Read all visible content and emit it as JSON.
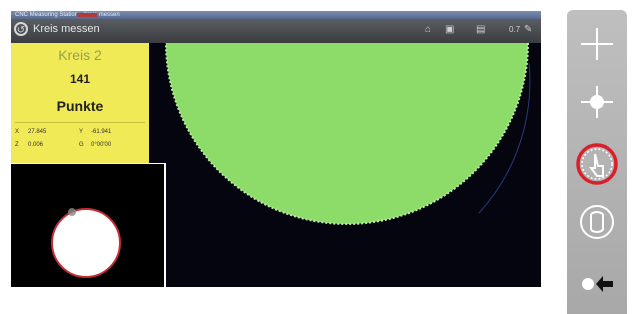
{
  "window": {
    "title_bar_text": "CNC Measuring Station - Kreis messen"
  },
  "toolbar": {
    "back_icon": "back-arrow-icon",
    "title": "Kreis messen",
    "icons": [
      "home-icon",
      "camera-icon",
      "keyboard-icon"
    ],
    "zoom_label": "0.7",
    "pen_icon": "pen-icon"
  },
  "panel": {
    "feature": "Kreis 2",
    "count": "141",
    "unit": "Punkte",
    "x_label": "X",
    "x_value": "27.845",
    "y_label": "Y",
    "y_value": "-61.941",
    "z_label": "Z",
    "z_value": "0.006",
    "g_label": "G",
    "g_value": "0°00'00"
  },
  "colors": {
    "panel_bg": "#f1ea57",
    "measured_area": "#8ddc6a",
    "edge_points": "#b9f0a2",
    "fit_circle": "#c22e36",
    "active_tool_ring": "#d91f2a"
  },
  "sidebar": {
    "tools": [
      "crosshair-icon",
      "point-probe-icon",
      "manual-touch-icon",
      "circle-fit-icon",
      "light-arrow-icon"
    ],
    "active": "manual-touch-icon"
  }
}
